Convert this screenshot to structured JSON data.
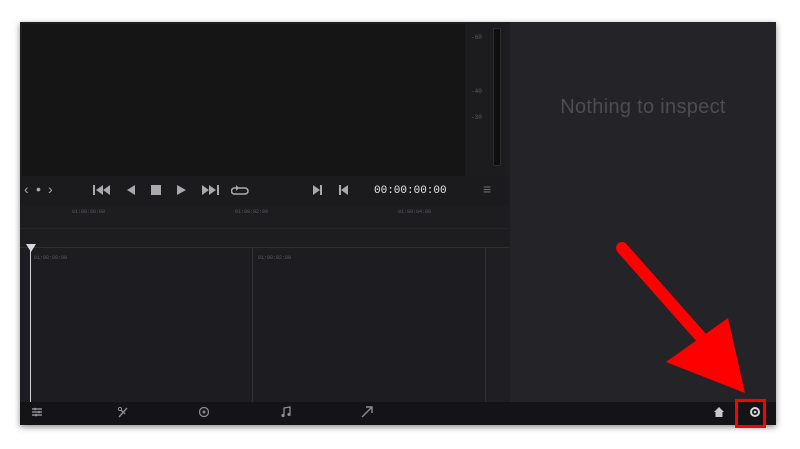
{
  "inspector": {
    "empty_message": "Nothing to inspect"
  },
  "viewer": {
    "meter_ticks": [
      "-60",
      "-40",
      "-30"
    ]
  },
  "transport": {
    "nav_prev": "‹",
    "nav_dot": "•",
    "nav_next": "›",
    "timecode": "00:00:00:00",
    "menu_icon": "≡"
  },
  "ruler": {
    "ticks": [
      "01:00:00:00",
      "01:00:02:00",
      "01:00:04:00"
    ]
  },
  "timeline": {
    "clip_timecodes": [
      "01:00:00:00",
      "01:00:02:00"
    ]
  },
  "bottombar": {
    "icons": [
      "media-icon",
      "cut-icon",
      "color-icon",
      "audio-icon",
      "deliver-icon",
      "home-icon",
      "settings-icon"
    ]
  },
  "annotation": {
    "arrow_color": "#ff0000",
    "highlight_color": "#ff0000"
  }
}
